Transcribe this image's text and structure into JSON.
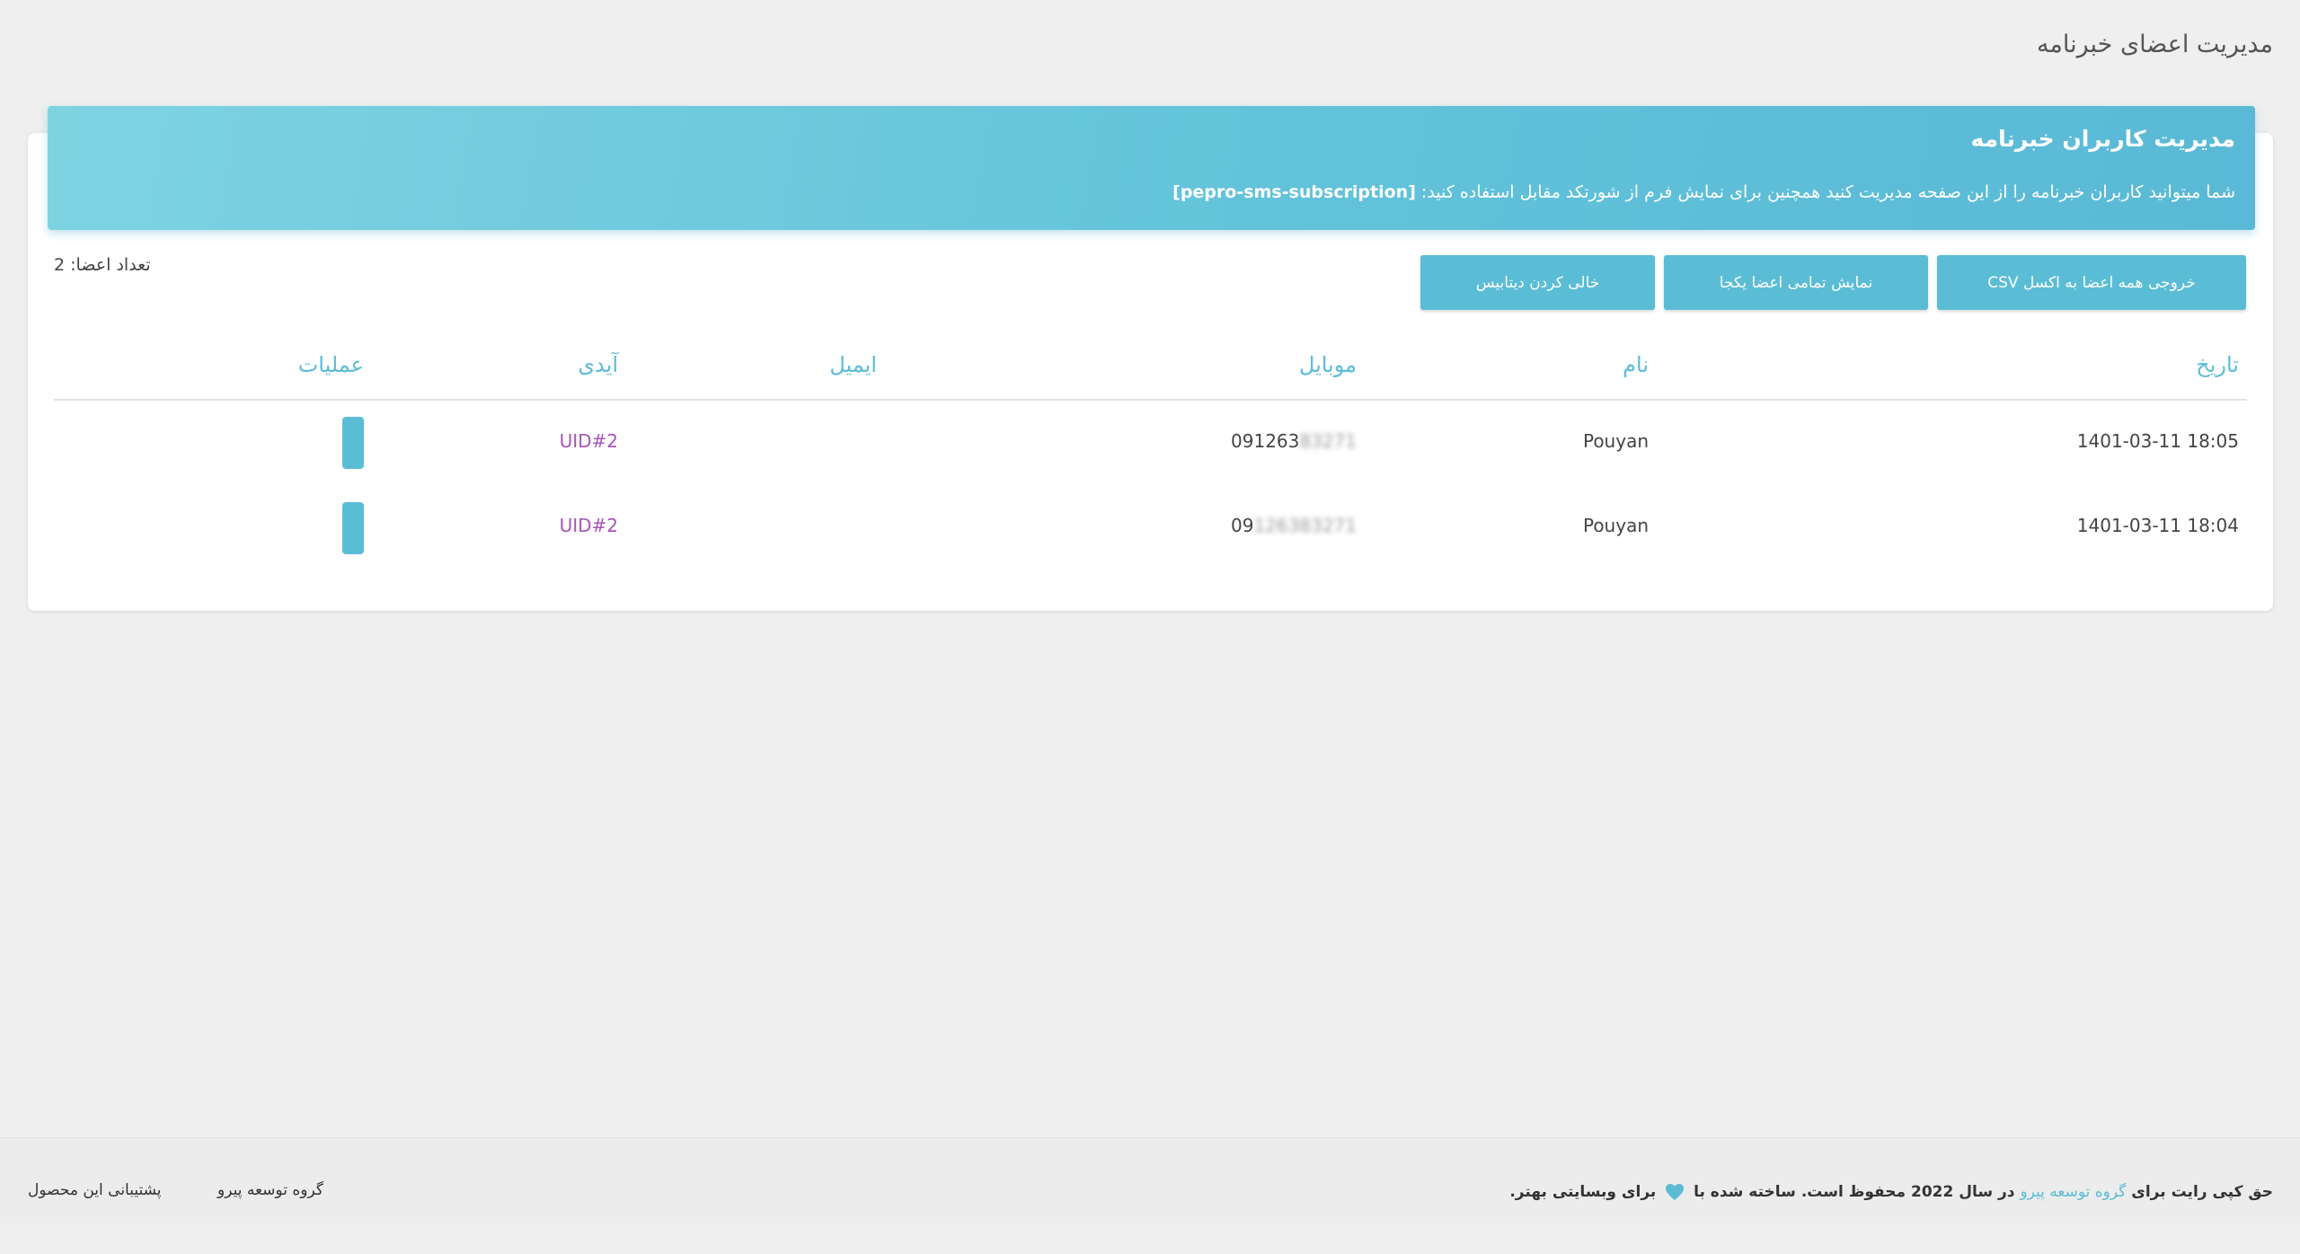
{
  "page": {
    "title": "مدیریت اعضای خبرنامه"
  },
  "banner": {
    "title": "مدیریت کاربران خبرنامه",
    "description": "شما میتوانید کاربران خبرنامه را از این صفحه مدیریت کنید همچنین برای نمایش فرم از شورتکد مقابل استفاده کنید: ",
    "shortcode": "[pepro-sms-subscription]"
  },
  "toolbar": {
    "member_count": "تعداد اعضا: 2",
    "csv_label": "خروجی همه اعضا به اکسل CSV",
    "show_all_label": "نمایش تمامی اعضا یکجا",
    "empty_db_label": "خالی کردن دیتابیس"
  },
  "table": {
    "headers": {
      "date": "تاریخ",
      "name": "نام",
      "mobile": "موبایل",
      "email": "ایمیل",
      "id": "آیدی",
      "operations": "عملیات"
    },
    "rows": [
      {
        "date": "1401-03-11 18:05",
        "name": "Pouyan",
        "mobile_visible": "091263",
        "mobile_blurred": "83271",
        "email": "",
        "id": "UID#2"
      },
      {
        "date": "1401-03-11 18:04",
        "name": "Pouyan",
        "mobile_visible": "09",
        "mobile_blurred": "126383271",
        "email": "",
        "id": "UID#2"
      }
    ]
  },
  "footer": {
    "copyright_prefix": "حق کپی رایت برای ",
    "copyright_link": "گروه توسعه پیرو",
    "copyright_middle": " در سال 2022 محفوظ است. ساخته شده با ",
    "copyright_suffix": " برای وبسایتی بهتر.",
    "link_company": "گروه توسعه پیرو",
    "link_support": "پشتیبانی این محصول"
  },
  "colors": {
    "accent": "#5bbcd6",
    "uid": "#a456b8",
    "background": "#efefef"
  },
  "icons": {
    "heart": "heart-icon"
  }
}
